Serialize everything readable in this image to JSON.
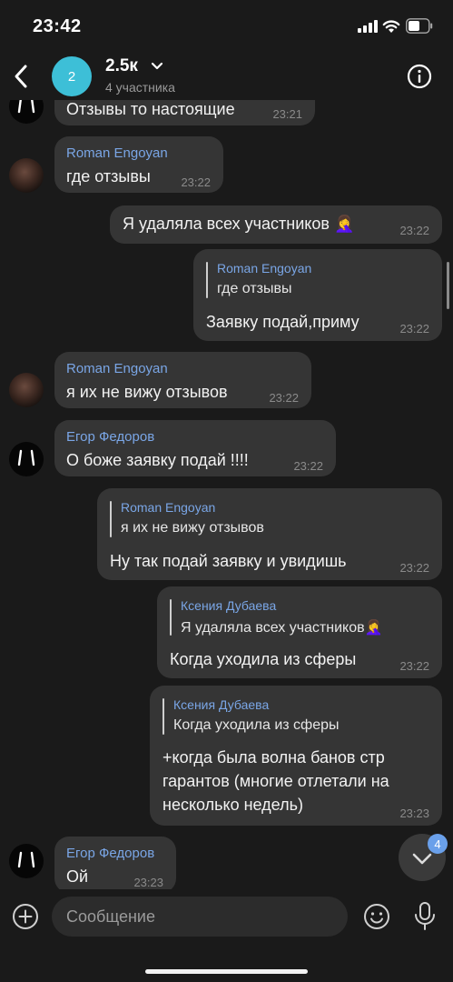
{
  "status_bar": {
    "time": "23:42"
  },
  "header": {
    "avatar_letter": "2",
    "title": "2.5к",
    "subtitle": "4 участника"
  },
  "emoji": {
    "facepalm": "🤦‍♀️"
  },
  "messages": [
    {
      "text": "Отзывы то настоящие",
      "time": "23:21",
      "side": "incoming"
    },
    {
      "sender": "Roman Engoyan",
      "text": "где отзывы",
      "time": "23:22",
      "side": "incoming"
    },
    {
      "text": "Я удаляла всех участников",
      "time": "23:22",
      "side": "outgoing"
    },
    {
      "reply_to": {
        "name": "Roman Engoyan",
        "text": "где отзывы"
      },
      "text": "Заявку подай,приму",
      "time": "23:22",
      "side": "outgoing"
    },
    {
      "sender": "Roman Engoyan",
      "text": "я их не вижу отзывов",
      "time": "23:22",
      "side": "incoming"
    },
    {
      "sender": "Егор Федоров",
      "text": "О боже заявку подай !!!!",
      "time": "23:22",
      "side": "incoming"
    },
    {
      "reply_to": {
        "name": "Roman Engoyan",
        "text": "я их не вижу отзывов"
      },
      "text": "Ну так подай заявку и увидишь",
      "time": "23:22",
      "side": "outgoing"
    },
    {
      "reply_to": {
        "name": "Ксения Дубаева",
        "text": "Я удаляла всех участников"
      },
      "text": "Когда уходила из сферы",
      "time": "23:22",
      "side": "outgoing"
    },
    {
      "reply_to": {
        "name": "Ксения Дубаева",
        "text": "Когда уходила из сферы"
      },
      "text": "+когда была волна банов стр гарантов (многие отлетали на несколько недель)",
      "time": "23:23",
      "side": "outgoing"
    },
    {
      "sender": "Егор Федоров",
      "text": "Ой",
      "time": "23:23",
      "side": "incoming"
    }
  ],
  "scroll_down_badge": "4",
  "input": {
    "placeholder": "Сообщение"
  }
}
